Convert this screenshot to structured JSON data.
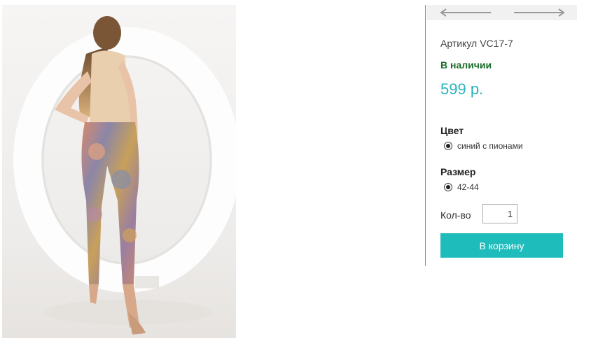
{
  "product": {
    "image_alt": "Модель в леггинсах с цветочным принтом",
    "sku_label": "Артикул",
    "sku_value": "VC17-7",
    "stock_status": "В наличии",
    "price": "599 р."
  },
  "navigation": {
    "prev_icon": "arrow-left-icon",
    "next_icon": "arrow-right-icon"
  },
  "options": {
    "color_title": "Цвет",
    "color_value": "синий с пионами",
    "size_title": "Размер",
    "size_value": "42-44"
  },
  "quantity": {
    "label": "Кол-во",
    "value": "1"
  },
  "cart": {
    "button_label": "В корзину"
  },
  "colors": {
    "accent": "#1fbcbc",
    "price": "#2ab5bb",
    "in_stock": "#1b6b2b",
    "divider": "#2bbcc0"
  }
}
